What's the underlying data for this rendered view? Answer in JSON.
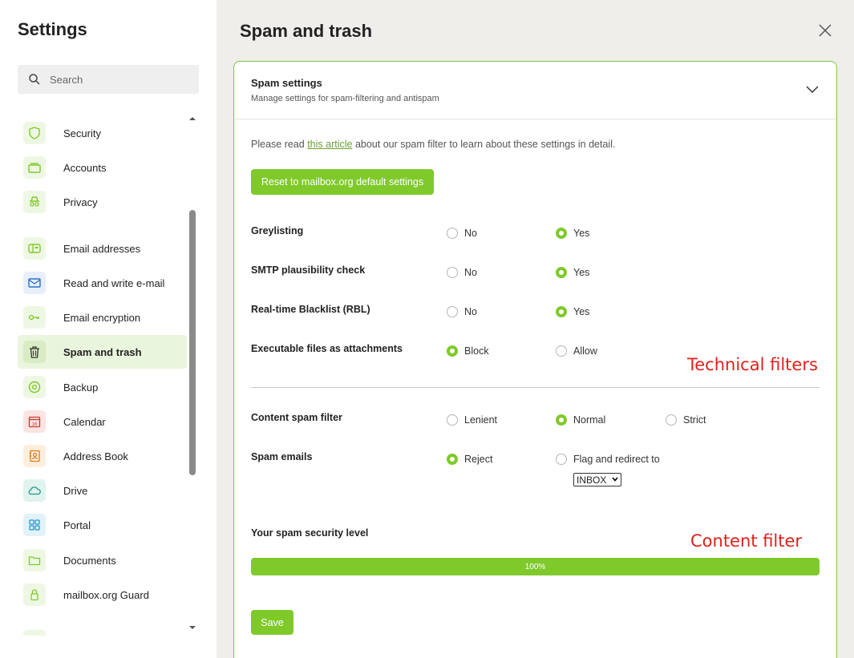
{
  "sidebar": {
    "title": "Settings",
    "search_placeholder": "Search",
    "items": [
      {
        "label": "Security",
        "icon": "shield-icon"
      },
      {
        "label": "Accounts",
        "icon": "accounts-icon"
      },
      {
        "label": "Privacy",
        "icon": "incognito-icon"
      },
      {
        "label": "Email addresses",
        "icon": "mailbox-icon"
      },
      {
        "label": "Read and write e-mail",
        "icon": "envelope-icon"
      },
      {
        "label": "Email encryption",
        "icon": "key-icon"
      },
      {
        "label": "Spam and trash",
        "icon": "trash-icon",
        "active": true
      },
      {
        "label": "Backup",
        "icon": "backup-icon"
      },
      {
        "label": "Calendar",
        "icon": "calendar-icon",
        "badge": "16"
      },
      {
        "label": "Address Book",
        "icon": "address-book-icon"
      },
      {
        "label": "Drive",
        "icon": "cloud-icon"
      },
      {
        "label": "Portal",
        "icon": "grid-icon"
      },
      {
        "label": "Documents",
        "icon": "folder-icon"
      },
      {
        "label": "mailbox.org Guard",
        "icon": "lock-icon"
      }
    ]
  },
  "main": {
    "title": "Spam and trash",
    "panel": {
      "title": "Spam settings",
      "subtitle": "Manage settings for spam-filtering and antispam",
      "intro_before": "Please read ",
      "intro_link": "this article",
      "intro_after": " about our spam filter to learn about these settings in detail.",
      "reset_label": "Reset to mailbox.org default settings",
      "rows": {
        "greylisting": {
          "label": "Greylisting",
          "options": [
            "No",
            "Yes"
          ],
          "selected": "Yes"
        },
        "smtp": {
          "label": "SMTP plausibility check",
          "options": [
            "No",
            "Yes"
          ],
          "selected": "Yes"
        },
        "rbl": {
          "label": "Real-time Blacklist (RBL)",
          "options": [
            "No",
            "Yes"
          ],
          "selected": "Yes"
        },
        "executables": {
          "label": "Executable files as attachments",
          "options": [
            "Block",
            "Allow"
          ],
          "selected": "Block"
        },
        "content": {
          "label": "Content spam filter",
          "options": [
            "Lenient",
            "Normal",
            "Strict"
          ],
          "selected": "Normal"
        },
        "spam_emails": {
          "label": "Spam emails",
          "options": [
            "Reject",
            "Flag and redirect to"
          ],
          "selected": "Reject",
          "folder": "INBOX"
        }
      },
      "security_level_label": "Your spam security level",
      "security_level_value": "100%",
      "security_level_fraction": 1.0,
      "save_label": "Save"
    },
    "annotations": {
      "technical": "Technical filters",
      "content": "Content filter"
    }
  },
  "colors": {
    "accent": "#7fca2a",
    "annotation": "#e0201a"
  }
}
